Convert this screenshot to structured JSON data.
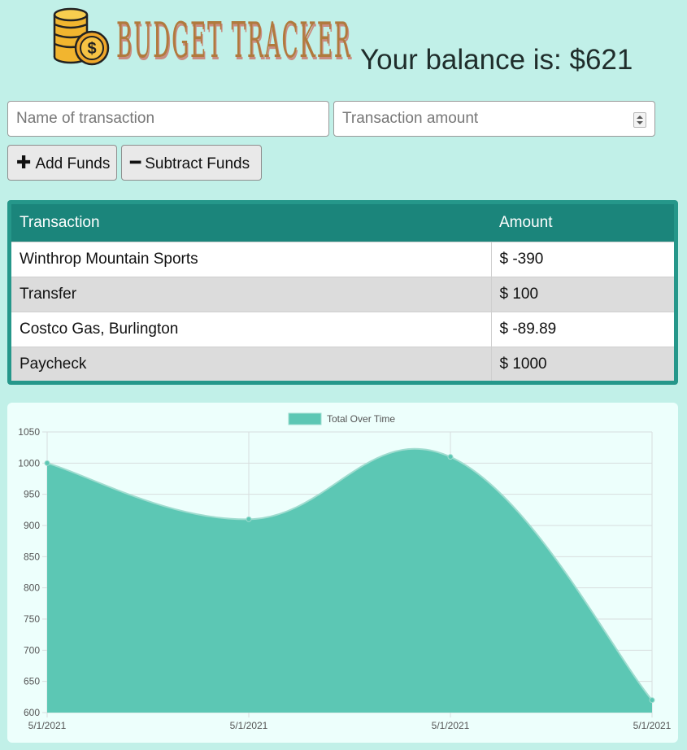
{
  "header": {
    "app_title": "BUDGET TRACKER",
    "balance_text": "Your balance is: $621"
  },
  "form": {
    "name_placeholder": "Name of transaction",
    "amount_placeholder": "Transaction amount",
    "add_label": "Add Funds",
    "subtract_label": "Subtract Funds"
  },
  "table": {
    "columns": [
      "Transaction",
      "Amount"
    ],
    "rows": [
      {
        "name": "Winthrop Mountain Sports",
        "amount": "$ -390"
      },
      {
        "name": "Transfer",
        "amount": "$ 100"
      },
      {
        "name": "Costco Gas, Burlington",
        "amount": "$ -89.89"
      },
      {
        "name": "Paycheck",
        "amount": "$ 1000"
      }
    ]
  },
  "colors": {
    "background": "#c1f0e8",
    "table_header": "#1b857b",
    "area_fill": "#5cc7b4",
    "area_line": "#9fdccf"
  },
  "chart_data": {
    "type": "area",
    "legend": "Total Over Time",
    "legend_position": "top",
    "x": [
      "5/1/2021",
      "5/1/2021",
      "5/1/2021",
      "5/1/2021"
    ],
    "values": [
      1000,
      910,
      1010,
      620
    ],
    "ylim": [
      600,
      1050
    ],
    "yticks": [
      600,
      650,
      700,
      750,
      800,
      850,
      900,
      950,
      1000,
      1050
    ],
    "grid": true
  }
}
